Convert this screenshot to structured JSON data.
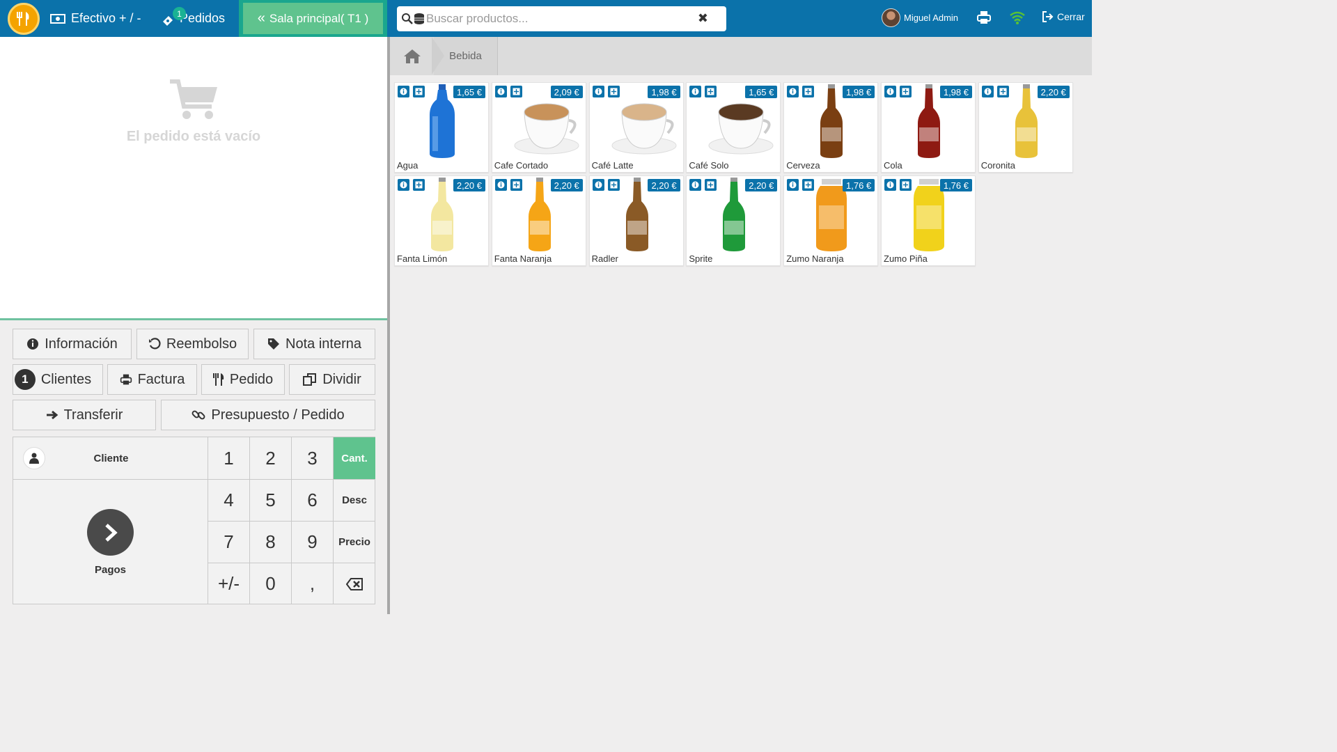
{
  "topbar": {
    "efectivo_label": "Efectivo + / -",
    "pedidos_label": "Pedidos",
    "pedidos_badge": "1",
    "sala_label": "Sala principal( T1 )",
    "search_placeholder": "Buscar productos...",
    "user_name": "Miguel Admin",
    "cerrar_label": "Cerrar"
  },
  "order": {
    "empty_message": "El pedido está vacío"
  },
  "actions": {
    "informacion": "Información",
    "reembolso": "Reembolso",
    "nota_interna": "Nota interna",
    "clientes": "Clientes",
    "clientes_badge": "1",
    "factura": "Factura",
    "pedido": "Pedido",
    "dividir": "Dividir",
    "transferir": "Transferir",
    "presupuesto": "Presupuesto / Pedido"
  },
  "numpad": {
    "cliente": "Cliente",
    "pagos": "Pagos",
    "keys": [
      "1",
      "2",
      "3",
      "4",
      "5",
      "6",
      "7",
      "8",
      "9",
      "+/-",
      "0",
      ","
    ],
    "cant": "Cant.",
    "desc": "Desc",
    "precio": "Precio"
  },
  "breadcrumb": {
    "category": "Bebida"
  },
  "products": [
    {
      "name": "Agua",
      "price": "1,65 €",
      "kind": "water",
      "color": "#1e73d6"
    },
    {
      "name": "Cafe Cortado",
      "price": "2,09 €",
      "kind": "cup",
      "color": "#c8925a"
    },
    {
      "name": "Café Latte",
      "price": "1,98 €",
      "kind": "cup",
      "color": "#d9b48a"
    },
    {
      "name": "Café Solo",
      "price": "1,65 €",
      "kind": "cup",
      "color": "#5a3a22"
    },
    {
      "name": "Cerveza",
      "price": "1,98 €",
      "kind": "bottle",
      "color": "#7a3f12"
    },
    {
      "name": "Cola",
      "price": "1,98 €",
      "kind": "bottle",
      "color": "#8e1a12"
    },
    {
      "name": "Coronita",
      "price": "2,20 €",
      "kind": "bottle",
      "color": "#e8c23a"
    },
    {
      "name": "Fanta Limón",
      "price": "2,20 €",
      "kind": "bottle",
      "color": "#f3e7a0"
    },
    {
      "name": "Fanta Naranja",
      "price": "2,20 €",
      "kind": "bottle",
      "color": "#f5a516"
    },
    {
      "name": "Radler",
      "price": "2,20 €",
      "kind": "bottle",
      "color": "#8a5a26"
    },
    {
      "name": "Sprite",
      "price": "2,20 €",
      "kind": "bottle",
      "color": "#1f9a3a"
    },
    {
      "name": "Zumo Naranja",
      "price": "1,76 €",
      "kind": "jar",
      "color": "#f19a1b"
    },
    {
      "name": "Zumo Piña",
      "price": "1,76 €",
      "kind": "jar",
      "color": "#f1d21b"
    }
  ]
}
